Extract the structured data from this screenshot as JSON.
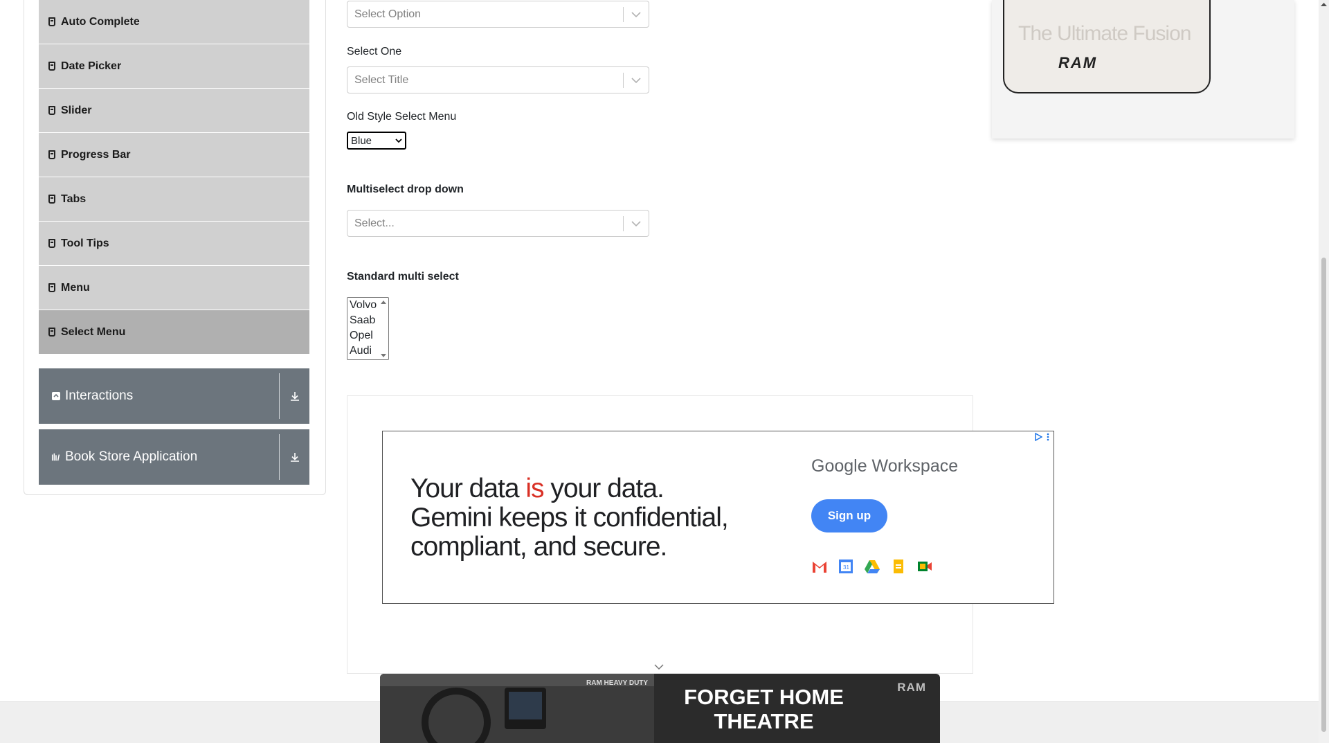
{
  "sidebar": {
    "items": [
      {
        "label": "Auto Complete"
      },
      {
        "label": "Date Picker"
      },
      {
        "label": "Slider"
      },
      {
        "label": "Progress Bar"
      },
      {
        "label": "Tabs"
      },
      {
        "label": "Tool Tips"
      },
      {
        "label": "Menu"
      },
      {
        "label": "Select Menu"
      }
    ],
    "groups": [
      {
        "label": "Interactions",
        "icon": "interactions-icon"
      },
      {
        "label": "Book Store Application",
        "icon": "books-icon"
      }
    ]
  },
  "form": {
    "select_option_placeholder": "Select Option",
    "select_one_label": "Select One",
    "select_one_placeholder": "Select Title",
    "old_style_label": "Old Style Select Menu",
    "old_style_value": "Blue",
    "multiselect_label": "Multiselect drop down",
    "multiselect_placeholder": "Select...",
    "standard_multi_label": "Standard multi select",
    "standard_multi_options": [
      "Volvo",
      "Saab",
      "Opel",
      "Audi"
    ]
  },
  "ads": {
    "main": {
      "headline_part1": "Your data ",
      "headline_red": "is",
      "headline_part2": " your data.",
      "headline_line2": "Gemini keeps it confidential,",
      "headline_line3": "compliant, and secure.",
      "brand": "Google Workspace",
      "cta": "Sign up"
    },
    "top_right": {
      "tagline": "The Ultimate  Fusion",
      "brand": "RAM"
    },
    "bottom": {
      "headline_line1": "FORGET HOME",
      "headline_line2": "THEATRE",
      "brand": "RAM",
      "subtag": "RAM HEAVY DUTY"
    }
  }
}
